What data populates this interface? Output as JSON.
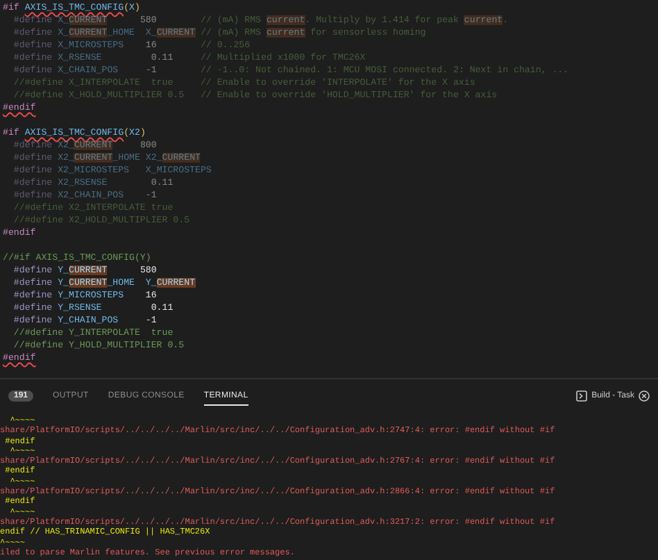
{
  "editor": {
    "blocks": [
      {
        "lines": [
          {
            "inactive": false,
            "segments": [
              {
                "kind": "dir",
                "text": "#if "
              },
              {
                "kind": "name_err",
                "text": "AXIS_IS_TMC_CONFIG"
              },
              {
                "kind": "paren",
                "text": "("
              },
              {
                "kind": "name",
                "text": "X"
              },
              {
                "kind": "paren",
                "text": ")"
              }
            ]
          },
          {
            "inactive": true,
            "segments": [
              {
                "kind": "def",
                "text": "  #define "
              },
              {
                "kind": "name",
                "text": "X_"
              },
              {
                "kind": "match",
                "text": "CURRENT"
              },
              {
                "kind": "value",
                "text": "      580"
              },
              {
                "kind": "comment",
                "text": "        // (mA) RMS "
              },
              {
                "kind": "match",
                "text": "current"
              },
              {
                "kind": "comment",
                "text": ". Multiply by 1.414 for peak "
              },
              {
                "kind": "match",
                "text": "current"
              },
              {
                "kind": "comment",
                "text": "."
              }
            ]
          },
          {
            "inactive": true,
            "segments": [
              {
                "kind": "def",
                "text": "  #define "
              },
              {
                "kind": "name",
                "text": "X_"
              },
              {
                "kind": "match",
                "text": "CURRENT"
              },
              {
                "kind": "name",
                "text": "_HOME"
              },
              {
                "kind": "name",
                "text": "  X_"
              },
              {
                "kind": "match",
                "text": "CURRENT"
              },
              {
                "kind": "comment",
                "text": " // (mA) RMS "
              },
              {
                "kind": "match",
                "text": "current"
              },
              {
                "kind": "comment",
                "text": " for sensorless homing"
              }
            ]
          },
          {
            "inactive": true,
            "segments": [
              {
                "kind": "def",
                "text": "  #define "
              },
              {
                "kind": "name",
                "text": "X_MICROSTEPS"
              },
              {
                "kind": "value",
                "text": "    16"
              },
              {
                "kind": "comment",
                "text": "        // 0..256"
              }
            ]
          },
          {
            "inactive": true,
            "segments": [
              {
                "kind": "def",
                "text": "  #define "
              },
              {
                "kind": "name",
                "text": "X_RSENSE"
              },
              {
                "kind": "value",
                "text": "         0.11"
              },
              {
                "kind": "comment",
                "text": "     // Multiplied x1000 for TMC26X"
              }
            ]
          },
          {
            "inactive": true,
            "segments": [
              {
                "kind": "def",
                "text": "  #define "
              },
              {
                "kind": "name",
                "text": "X_CHAIN_POS"
              },
              {
                "kind": "value",
                "text": "     -1"
              },
              {
                "kind": "comment",
                "text": "        // -1..0: Not chained. 1: MCU MOSI connected. 2: Next in chain, ..."
              }
            ]
          },
          {
            "inactive": true,
            "segments": [
              {
                "kind": "comment",
                "text": "  //#define X_INTERPOLATE  true     // Enable to override 'INTERPOLATE' for the X axis"
              }
            ]
          },
          {
            "inactive": true,
            "segments": [
              {
                "kind": "comment",
                "text": "  //#define X_HOLD_MULTIPLIER 0.5   // Enable to override 'HOLD_MULTIPLIER' for the X axis"
              }
            ]
          },
          {
            "inactive": false,
            "segments": [
              {
                "kind": "dir_err",
                "text": "#endif"
              }
            ]
          }
        ]
      },
      {
        "lines": [
          {
            "inactive": false,
            "segments": [
              {
                "kind": "dir",
                "text": "#if "
              },
              {
                "kind": "name_err",
                "text": "AXIS_IS_TMC_CONFIG"
              },
              {
                "kind": "paren",
                "text": "("
              },
              {
                "kind": "name",
                "text": "X2"
              },
              {
                "kind": "paren",
                "text": ")"
              }
            ]
          },
          {
            "inactive": true,
            "segments": [
              {
                "kind": "def",
                "text": "  #define "
              },
              {
                "kind": "name",
                "text": "X2_"
              },
              {
                "kind": "match",
                "text": "CURRENT"
              },
              {
                "kind": "value",
                "text": "     800"
              }
            ]
          },
          {
            "inactive": true,
            "segments": [
              {
                "kind": "def",
                "text": "  #define "
              },
              {
                "kind": "name",
                "text": "X2_"
              },
              {
                "kind": "match",
                "text": "CURRENT"
              },
              {
                "kind": "name",
                "text": "_HOME"
              },
              {
                "kind": "name",
                "text": " X2_"
              },
              {
                "kind": "match",
                "text": "CURRENT"
              }
            ]
          },
          {
            "inactive": true,
            "segments": [
              {
                "kind": "def",
                "text": "  #define "
              },
              {
                "kind": "name",
                "text": "X2_MICROSTEPS"
              },
              {
                "kind": "name",
                "text": "   X_MICROSTEPS"
              }
            ]
          },
          {
            "inactive": true,
            "segments": [
              {
                "kind": "def",
                "text": "  #define "
              },
              {
                "kind": "name",
                "text": "X2_RSENSE"
              },
              {
                "kind": "value",
                "text": "        0.11"
              }
            ]
          },
          {
            "inactive": true,
            "segments": [
              {
                "kind": "def",
                "text": "  #define "
              },
              {
                "kind": "name",
                "text": "X2_CHAIN_POS"
              },
              {
                "kind": "value",
                "text": "    -1"
              }
            ]
          },
          {
            "inactive": true,
            "segments": [
              {
                "kind": "comment",
                "text": "  //#define X2_INTERPOLATE true"
              }
            ]
          },
          {
            "inactive": true,
            "segments": [
              {
                "kind": "comment",
                "text": "  //#define X2_HOLD_MULTIPLIER 0.5"
              }
            ]
          },
          {
            "inactive": false,
            "segments": [
              {
                "kind": "dir",
                "text": "#endif"
              }
            ]
          }
        ]
      },
      {
        "lines": [
          {
            "inactive": false,
            "segments": [
              {
                "kind": "comment",
                "text": "//#if AXIS_IS_TMC_CONFIG(Y)"
              }
            ]
          },
          {
            "inactive": false,
            "segments": [
              {
                "kind": "def",
                "text": "  #define "
              },
              {
                "kind": "name",
                "text": "Y_"
              },
              {
                "kind": "match",
                "text": "CURRENT"
              },
              {
                "kind": "value",
                "text": "      580"
              }
            ]
          },
          {
            "inactive": false,
            "segments": [
              {
                "kind": "def",
                "text": "  #define "
              },
              {
                "kind": "name",
                "text": "Y_"
              },
              {
                "kind": "match",
                "text": "CURRENT"
              },
              {
                "kind": "name",
                "text": "_HOME"
              },
              {
                "kind": "name",
                "text": "  Y_"
              },
              {
                "kind": "match",
                "text": "CURRENT"
              }
            ]
          },
          {
            "inactive": false,
            "segments": [
              {
                "kind": "def",
                "text": "  #define "
              },
              {
                "kind": "name",
                "text": "Y_MICROSTEPS"
              },
              {
                "kind": "value",
                "text": "    16"
              }
            ]
          },
          {
            "inactive": false,
            "segments": [
              {
                "kind": "def",
                "text": "  #define "
              },
              {
                "kind": "name",
                "text": "Y_RSENSE"
              },
              {
                "kind": "value",
                "text": "         0.11"
              }
            ]
          },
          {
            "inactive": false,
            "segments": [
              {
                "kind": "def",
                "text": "  #define "
              },
              {
                "kind": "name",
                "text": "Y_CHAIN_POS"
              },
              {
                "kind": "value",
                "text": "     -1"
              }
            ]
          },
          {
            "inactive": false,
            "segments": [
              {
                "kind": "comment",
                "text": "  //#define Y_INTERPOLATE  true"
              }
            ]
          },
          {
            "inactive": false,
            "segments": [
              {
                "kind": "comment",
                "text": "  //#define Y_HOLD_MULTIPLIER 0.5"
              }
            ]
          },
          {
            "inactive": false,
            "segments": [
              {
                "kind": "dir_err",
                "text": "#endif"
              }
            ]
          }
        ]
      }
    ]
  },
  "panel": {
    "problems_count": "191",
    "tabs": [
      {
        "label": "OUTPUT",
        "selected": false
      },
      {
        "label": "DEBUG CONSOLE",
        "selected": false
      },
      {
        "label": "TERMINAL",
        "selected": true
      }
    ],
    "task": {
      "label": "Build - Task"
    }
  },
  "terminal": {
    "lines": [
      {
        "kind": "caret",
        "text": "  ^~~~~"
      },
      {
        "kind": "error",
        "text": "share/PlatformIO/scripts/../../../../Marlin/src/inc/../../Configuration_adv.h:2747:4: error: #endif without #if"
      },
      {
        "kind": "source",
        "text": " #endif"
      },
      {
        "kind": "caret",
        "text": "  ^~~~~"
      },
      {
        "kind": "error",
        "text": "share/PlatformIO/scripts/../../../../Marlin/src/inc/../../Configuration_adv.h:2767:4: error: #endif without #if"
      },
      {
        "kind": "source",
        "text": " #endif"
      },
      {
        "kind": "caret",
        "text": "  ^~~~~"
      },
      {
        "kind": "error",
        "text": "share/PlatformIO/scripts/../../../../Marlin/src/inc/../../Configuration_adv.h:2866:4: error: #endif without #if"
      },
      {
        "kind": "source",
        "text": " #endif"
      },
      {
        "kind": "caret",
        "text": "  ^~~~~"
      },
      {
        "kind": "error",
        "text": "share/PlatformIO/scripts/../../../../Marlin/src/inc/../../Configuration_adv.h:3217:2: error: #endif without #if"
      },
      {
        "kind": "source",
        "text": "endif // HAS_TRINAMIC_CONFIG || HAS_TMC26X"
      },
      {
        "kind": "caret",
        "text": "^~~~~"
      },
      {
        "kind": "error",
        "text": "iled to parse Marlin features. See previous error messages."
      }
    ]
  }
}
